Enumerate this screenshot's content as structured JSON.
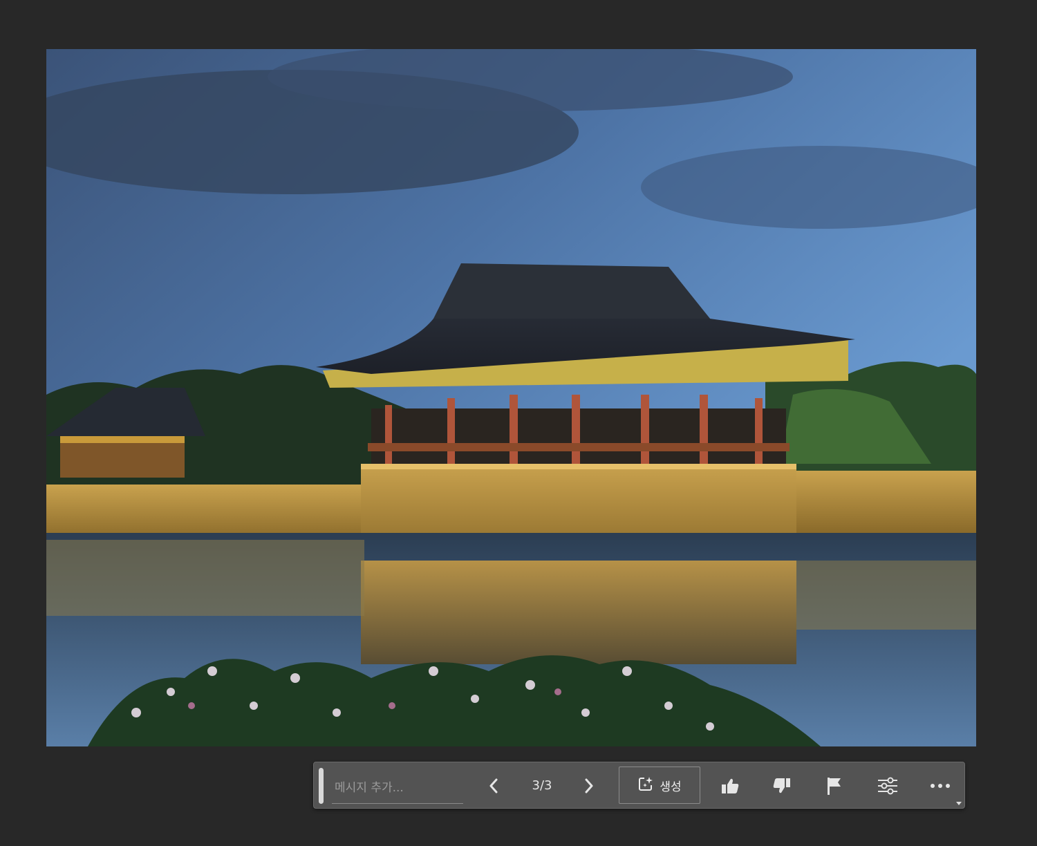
{
  "canvas": {
    "image_description_name": "photo-canvas"
  },
  "taskbar": {
    "prompt_placeholder": "메시지 추가...",
    "prompt_value": "",
    "variation_counter": "3/3",
    "generate_label": "생성",
    "icons": {
      "grip": "drag-handle-icon",
      "prev": "chevron-left-icon",
      "next": "chevron-right-icon",
      "generate": "generative-sparkle-icon",
      "like": "thumbs-up-icon",
      "dislike": "thumbs-down-icon",
      "report": "flag-icon",
      "settings": "sliders-icon",
      "more": "ellipsis-icon"
    }
  },
  "colors": {
    "workspace_bg": "#282828",
    "taskbar_bg": "#535353",
    "icon_color": "#e6e6e6"
  }
}
